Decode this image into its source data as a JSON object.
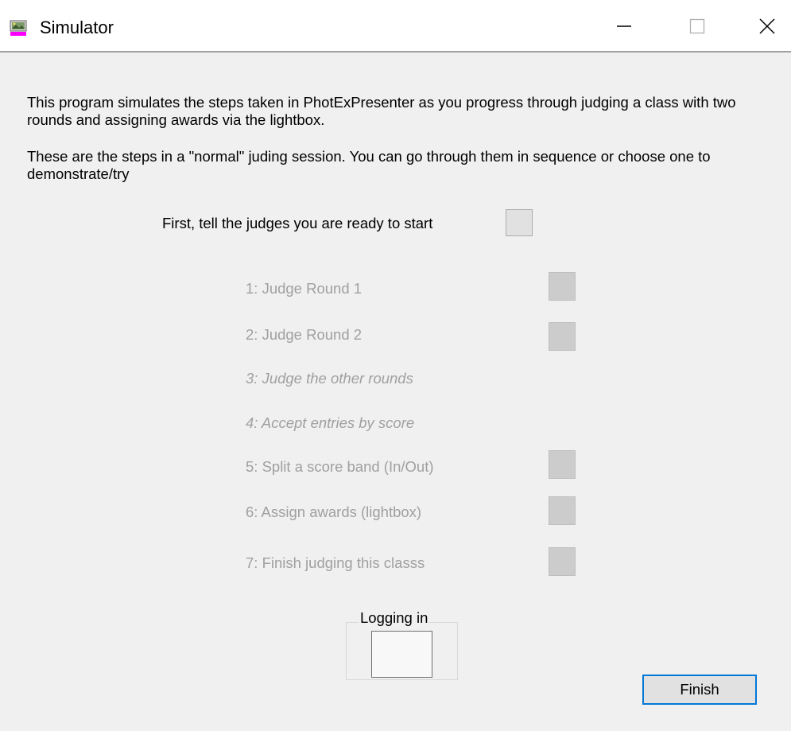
{
  "window": {
    "title": "Simulator",
    "icon": "simulator-app-icon",
    "controls": [
      "minimize-icon",
      "maximize-icon",
      "close-icon"
    ]
  },
  "intro": {
    "line1": "This program simulates the steps taken in PhotExPresenter as you progress through judging a class with two rounds and assigning awards via the lightbox.",
    "line2": "These are the steps in a \"normal\" juding session. You can go through them in sequence or choose one to demonstrate/try"
  },
  "first": {
    "label": "First, tell the judges you are ready to start"
  },
  "steps": [
    {
      "label": "1: Judge Round 1"
    },
    {
      "label": "2: Judge Round 2"
    },
    {
      "label": "3: Judge the other rounds"
    },
    {
      "label": "4: Accept entries by score"
    },
    {
      "label": "5: Split a score band (In/Out)"
    },
    {
      "label": "6: Assign awards (lightbox)"
    },
    {
      "label": "7: Finish judging this classs"
    }
  ],
  "logging": {
    "label": "Logging in"
  },
  "buttons": {
    "finish": "Finish"
  },
  "colors": {
    "background": "#f0f0f0",
    "disabled_text": "#a0a0a0",
    "focus_border": "#0078d7"
  }
}
